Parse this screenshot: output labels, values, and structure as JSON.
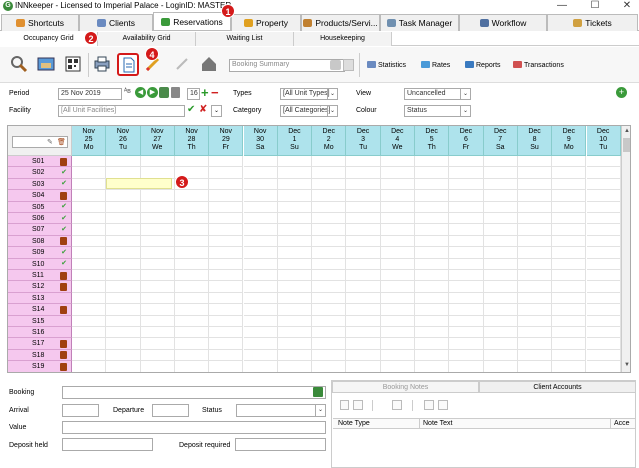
{
  "window": {
    "title": "INNkeeper - Licensed to Imperial Palace - LoginID: MASTER",
    "controls": [
      "—",
      "☐",
      "✕"
    ]
  },
  "main_tabs": [
    {
      "label": "Shortcuts"
    },
    {
      "label": "Clients"
    },
    {
      "label": "Reservations"
    },
    {
      "label": "Property"
    },
    {
      "label": "Products/Servi..."
    },
    {
      "label": "Task Manager"
    },
    {
      "label": "Workflow"
    },
    {
      "label": "Tickets"
    }
  ],
  "sub_tabs": [
    {
      "label": "Occupancy Grid"
    },
    {
      "label": "Availability Grid"
    },
    {
      "label": "Waiting List"
    },
    {
      "label": "Housekeeping"
    }
  ],
  "badges": [
    "1",
    "2",
    "3",
    "4"
  ],
  "toolbar": {
    "booking_summary_placeholder": "Booking Summary",
    "statistics": "Statistics",
    "rates": "Rates",
    "reports": "Reports",
    "transactions": "Transactions"
  },
  "filters": {
    "period_label": "Period",
    "period_value": "25 Nov 2019",
    "days_value": "16",
    "types_label": "Types",
    "types_value": "[All Unit Types]",
    "view_label": "View",
    "view_value": "Uncancelled",
    "facility_label": "Facility",
    "facility_value": "[All Unit Facilities]",
    "category_label": "Category",
    "category_value": "[All Categories]",
    "colour_label": "Colour",
    "colour_value": "Status"
  },
  "grid": {
    "dates": [
      {
        "month": "Nov",
        "day": "25",
        "dow": "Mo"
      },
      {
        "month": "Nov",
        "day": "26",
        "dow": "Tu"
      },
      {
        "month": "Nov",
        "day": "27",
        "dow": "We"
      },
      {
        "month": "Nov",
        "day": "28",
        "dow": "Th"
      },
      {
        "month": "Nov",
        "day": "29",
        "dow": "Fr"
      },
      {
        "month": "Nov",
        "day": "30",
        "dow": "Sa"
      },
      {
        "month": "Dec",
        "day": "1",
        "dow": "Su"
      },
      {
        "month": "Dec",
        "day": "2",
        "dow": "Mo"
      },
      {
        "month": "Dec",
        "day": "3",
        "dow": "Tu"
      },
      {
        "month": "Dec",
        "day": "4",
        "dow": "We"
      },
      {
        "month": "Dec",
        "day": "5",
        "dow": "Th"
      },
      {
        "month": "Dec",
        "day": "6",
        "dow": "Fr"
      },
      {
        "month": "Dec",
        "day": "7",
        "dow": "Sa"
      },
      {
        "month": "Dec",
        "day": "8",
        "dow": "Su"
      },
      {
        "month": "Dec",
        "day": "9",
        "dow": "Mo"
      },
      {
        "month": "Dec",
        "day": "10",
        "dow": "Tu"
      }
    ],
    "rooms": [
      {
        "id": "S01",
        "status": "trash"
      },
      {
        "id": "S02",
        "status": "check"
      },
      {
        "id": "S03",
        "status": "check"
      },
      {
        "id": "S04",
        "status": "trash"
      },
      {
        "id": "S05",
        "status": "check"
      },
      {
        "id": "S06",
        "status": "check"
      },
      {
        "id": "S07",
        "status": "check"
      },
      {
        "id": "S08",
        "status": "trash"
      },
      {
        "id": "S09",
        "status": "check"
      },
      {
        "id": "S10",
        "status": "check"
      },
      {
        "id": "S11",
        "status": "trash"
      },
      {
        "id": "S12",
        "status": "trash"
      },
      {
        "id": "S13",
        "status": "none"
      },
      {
        "id": "S14",
        "status": "trash"
      },
      {
        "id": "S15",
        "status": "none"
      },
      {
        "id": "S16",
        "status": "none"
      },
      {
        "id": "S17",
        "status": "trash"
      },
      {
        "id": "S18",
        "status": "trash"
      },
      {
        "id": "S19",
        "status": "trash"
      }
    ]
  },
  "booking": {
    "booking_label": "Booking",
    "arrival_label": "Arrival",
    "departure_label": "Departure",
    "status_label": "Status",
    "value_label": "Value",
    "deposit_held_label": "Deposit held",
    "deposit_required_label": "Deposit required"
  },
  "notes": {
    "tab_notes": "Booking Notes",
    "tab_accounts": "Client Accounts",
    "col_type": "Note Type",
    "col_text": "Note Text",
    "col_acc": "Acce"
  },
  "colors": {
    "header_cyan": "#aee3ec",
    "room_pink": "#f5c8ee",
    "badge_red": "#d41a1a",
    "selection_yellow": "#ffffcc"
  }
}
